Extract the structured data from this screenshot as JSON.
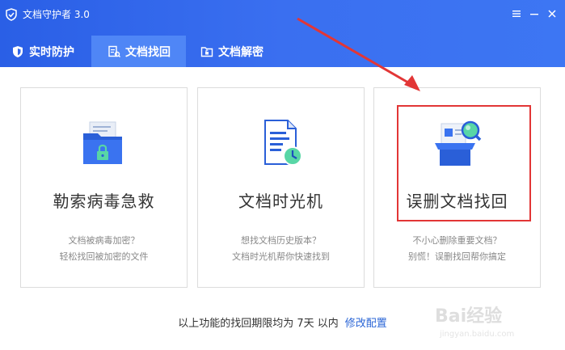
{
  "app": {
    "title": "文档守护者 3.0",
    "accent": "#2f66ea",
    "tab_active_bg": "#4f86f6"
  },
  "tabs": [
    {
      "label": "实时防护",
      "icon": "shield-icon",
      "active": false
    },
    {
      "label": "文档找回",
      "icon": "document-search-icon",
      "active": true
    },
    {
      "label": "文档解密",
      "icon": "unlock-folder-icon",
      "active": false
    }
  ],
  "cards": [
    {
      "title": "勒索病毒急救",
      "desc1": "文档被病毒加密？",
      "desc2": "轻松找回被加密的文件",
      "icon": "locked-folder-icon"
    },
    {
      "title": "文档时光机",
      "desc1": "想找文档历史版本？",
      "desc2": "文档时光机帮你快速找到",
      "icon": "document-clock-icon"
    },
    {
      "title": "误删文档找回",
      "desc1": "不小心删除重要文档？",
      "desc2": "别慌！误删找回帮你搞定",
      "icon": "box-magnifier-icon"
    }
  ],
  "footer": {
    "text": "以上功能的找回期限均为 7天 以内",
    "link": "修改配置"
  },
  "watermark": {
    "brand": "Bai经验",
    "url": "jingyan.baidu.com"
  }
}
